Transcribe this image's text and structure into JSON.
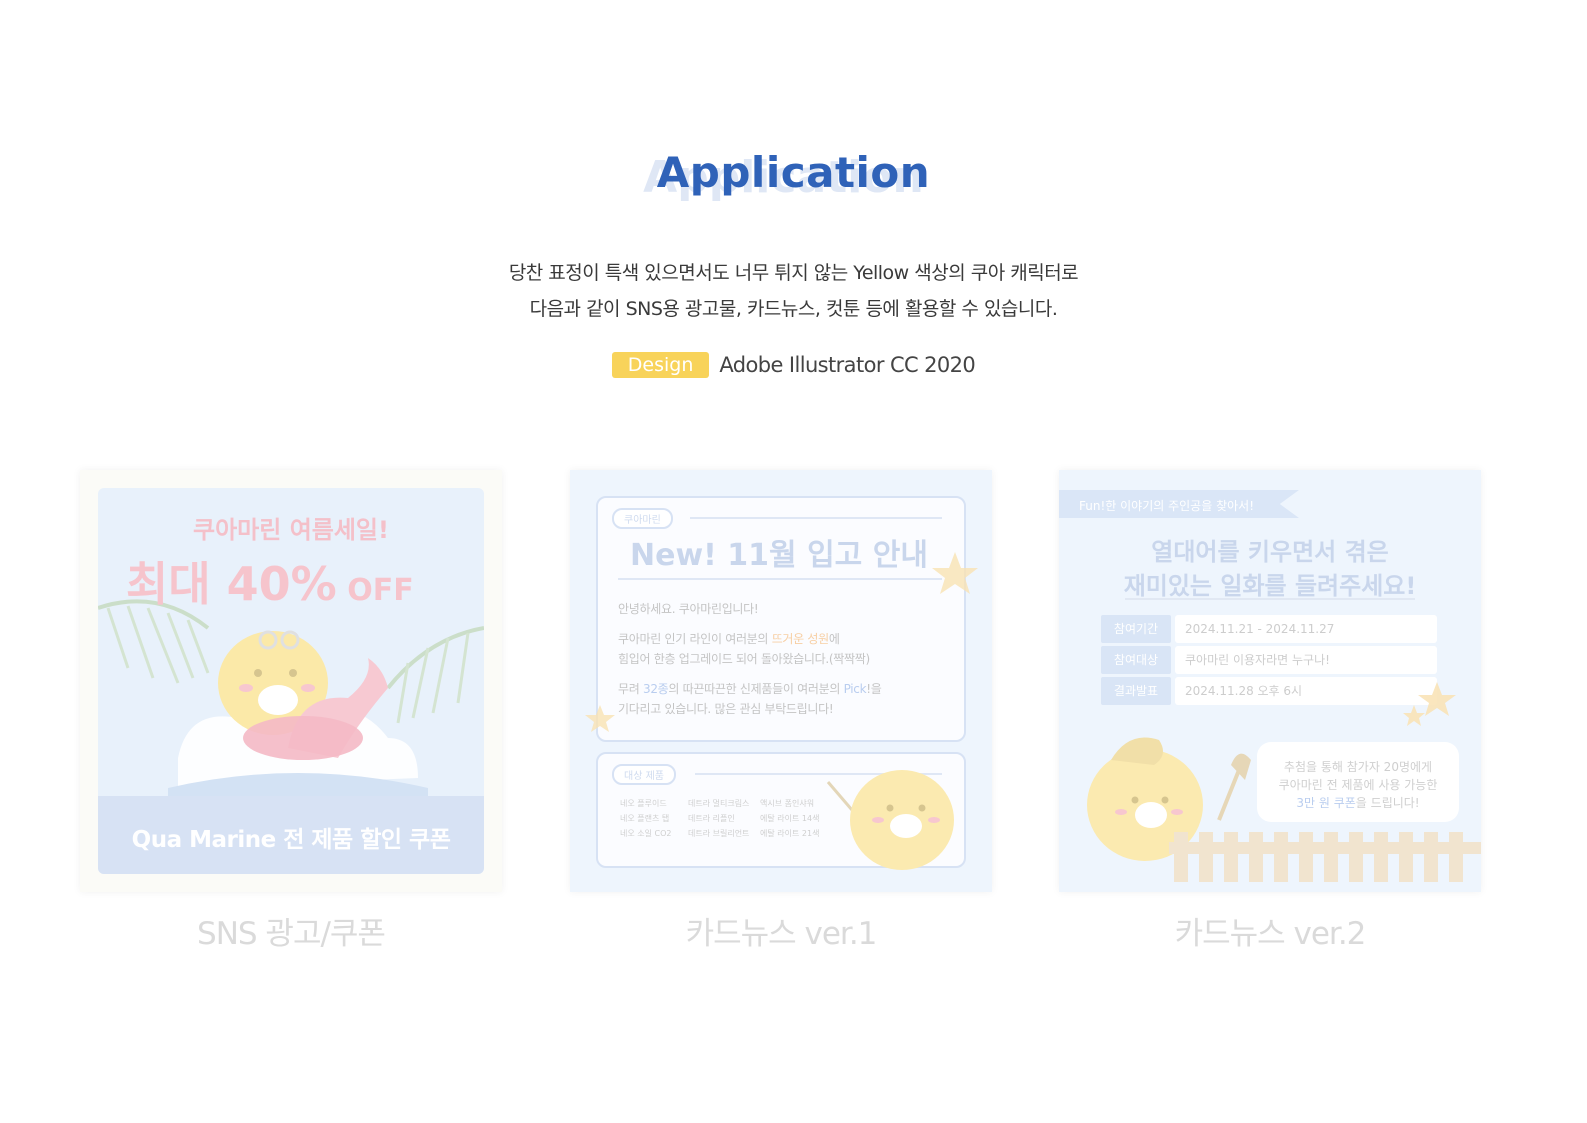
{
  "header": {
    "title": "Application",
    "desc_line1": "당찬 표정이 특색 있으면서도 너무 튀지 않는 Yellow 색상의 쿠아 캐릭터로",
    "desc_line2": "다음과 같이 SNS용 광고물, 카드뉴스, 컷툰 등에 활용할 수 있습니다.",
    "badge": "Design",
    "tool": "Adobe Illustrator CC 2020"
  },
  "colors": {
    "accent_blue": "#2f62b8",
    "badge_yellow": "#f8d35a",
    "caption_gray": "#dadada"
  },
  "cards": [
    {
      "caption": "SNS 광고/쿠폰",
      "headline": "쿠아마린 여름세일!",
      "discount_prefix": "최대 ",
      "discount_value": "40%",
      "discount_suffix": " OFF",
      "banner": "Qua Marine 전 제품 할인 쿠폰"
    },
    {
      "caption": "카드뉴스 ver.1",
      "tag1": "쿠아마린",
      "headline": "New! 11월 입고 안내",
      "greeting": "안녕하세요. 쿠아마린입니다!",
      "body1a": "쿠아마린 인기 라인이 여러분의 ",
      "body1_hl": "뜨거운 성원",
      "body1b": "에",
      "body2": "힘입어 한층 업그레이드 되어 돌아왔습니다.(짝짝짝)",
      "body3a": "무려 ",
      "body3_hl": "32종",
      "body3b": "의 따끈따끈한 신제품들이 여러분의 ",
      "body3_hl2": "Pick",
      "body3c": "!을",
      "body4": "기다리고 있습니다. 많은 관심 부탁드립니다!",
      "tag2": "대상 제품",
      "products": [
        [
          "네오 플루이드",
          "데트라 멀티크림스",
          "액시브 폼인샤워"
        ],
        [
          "네오 플랜츠 탭",
          "데트라 리플인",
          "에탈 라이트 14색"
        ],
        [
          "네오 소일 CO2",
          "데트라 브릴리언트",
          "에탈 라이트 21색"
        ]
      ]
    },
    {
      "caption": "카드뉴스 ver.2",
      "ribbon": "Fun!한 이야기의 주인공을 찾아서!",
      "headline1": "열대어를 키우면서 겪은",
      "headline2": "재미있는 일화를 들려주세요!",
      "rows": [
        {
          "label": "참여기간",
          "value": "2024.11.21 - 2024.11.27"
        },
        {
          "label": "참여대상",
          "value": "쿠아마린 이용자라면 누구나!"
        },
        {
          "label": "결과발표",
          "value": "2024.11.28 오후 6시"
        }
      ],
      "bubble1": "추첨을 통해 참가자 20명에게",
      "bubble2": "쿠아마린 전 제품에 사용 가능한",
      "bubble3_hl": "3만 원 쿠폰",
      "bubble3b": "을 드립니다!"
    }
  ]
}
